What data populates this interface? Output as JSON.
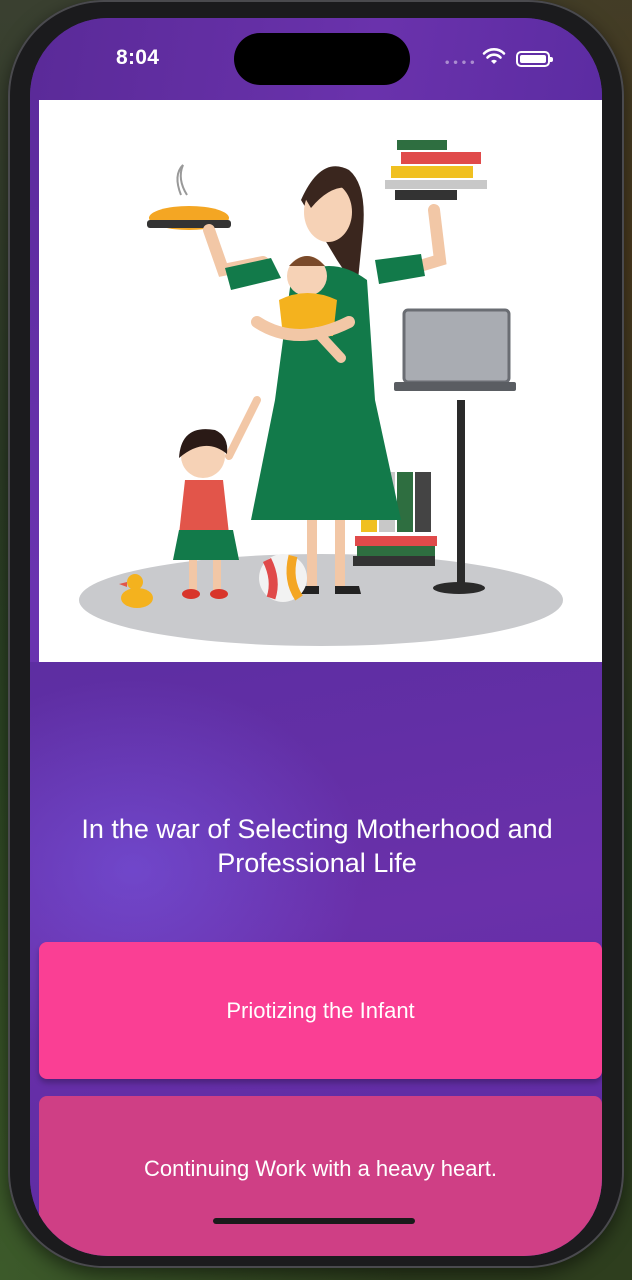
{
  "status": {
    "time": "8:04"
  },
  "question": {
    "text": "In the war of Selecting Motherhood and Professional Life"
  },
  "options": [
    {
      "label": "Priotizing the Infant"
    },
    {
      "label": "Continuing Work with a heavy heart."
    }
  ],
  "colors": {
    "header": "#5e2ea2",
    "option_primary": "#fa3f94",
    "option_secondary": "#cf3f85"
  },
  "illustration": {
    "subject": "working-mother-multitasking-illustration"
  }
}
